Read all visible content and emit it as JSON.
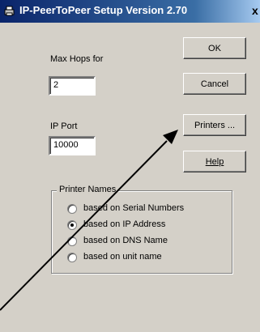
{
  "window": {
    "title": "IP-PeerToPeer Setup   Version 2.70",
    "close_glyph": "x"
  },
  "form": {
    "max_hops_label": "Max Hops for",
    "max_hops_value": "2",
    "ip_port_label": "IP Port",
    "ip_port_value": "10000"
  },
  "buttons": {
    "ok": "OK",
    "cancel": "Cancel",
    "printers": "Printers ...",
    "help": "Help"
  },
  "printer_names": {
    "title": "Printer Names",
    "options": [
      {
        "label": "based on Serial Numbers",
        "selected": false
      },
      {
        "label": "based on IP Address",
        "selected": true
      },
      {
        "label": "based on DNS Name",
        "selected": false
      },
      {
        "label": "based on unit name",
        "selected": false
      }
    ]
  },
  "colors": {
    "face": "#d4d0c8",
    "title_active": "#0a246a",
    "title_gradient_end": "#a6caf0"
  },
  "icons": {
    "app": "app-icon",
    "annotation": "arrow-annotation"
  }
}
